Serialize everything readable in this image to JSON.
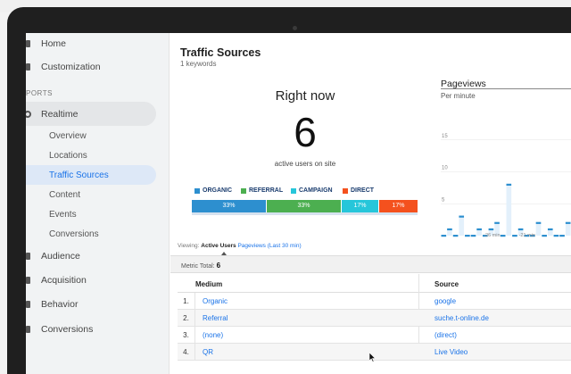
{
  "sidebar": {
    "home": "Home",
    "customization": "Customization",
    "section": "PORTS",
    "realtime": "Realtime",
    "sub_items": [
      "Overview",
      "Locations",
      "Traffic Sources",
      "Content",
      "Events",
      "Conversions"
    ],
    "audience": "Audience",
    "acquisition": "Acquisition",
    "behavior": "Behavior",
    "conversions": "Conversions"
  },
  "header": {
    "title": "Traffic Sources",
    "subtitle": "1 keywords"
  },
  "right_now": {
    "label": "Right now",
    "count": "6",
    "caption": "active users on site"
  },
  "legend": [
    {
      "label": "ORGANIC",
      "color": "#2d8fcf"
    },
    {
      "label": "REFERRAL",
      "color": "#4caf50"
    },
    {
      "label": "CAMPAIGN",
      "color": "#26c6da"
    },
    {
      "label": "DIRECT",
      "color": "#f4511e"
    }
  ],
  "distribution": [
    {
      "label": "33%",
      "value": 33.3,
      "color": "#2d8fcf"
    },
    {
      "label": "33%",
      "value": 33.3,
      "color": "#4caf50"
    },
    {
      "label": "17%",
      "value": 16.7,
      "color": "#26c6da"
    },
    {
      "label": "17%",
      "value": 16.7,
      "color": "#f4511e"
    }
  ],
  "pageviews": {
    "title": "Pageviews",
    "subtitle": "Per minute",
    "chart_data": {
      "type": "bar",
      "y_ticks": [
        "15",
        "10",
        "5"
      ],
      "x_labels": [
        "-26 min",
        "-21 min"
      ],
      "values": [
        0,
        1,
        0,
        3,
        0,
        0,
        1,
        0,
        1,
        2,
        0,
        8,
        0,
        1,
        0,
        0,
        2,
        0,
        1,
        0,
        0,
        2
      ],
      "ylim": [
        0,
        20
      ]
    }
  },
  "viewing": {
    "prefix": "Viewing:",
    "active": "Active Users",
    "alt": "Pageviews (Last 30 min)"
  },
  "metric_total": {
    "label": "Metric Total:",
    "value": "6"
  },
  "table": {
    "headers": [
      "Medium",
      "Source"
    ],
    "rows": [
      {
        "num": "1.",
        "medium": "Organic",
        "source": "google"
      },
      {
        "num": "2.",
        "medium": "Referral",
        "source": "suche.t-online.de"
      },
      {
        "num": "3.",
        "medium": "(none)",
        "source": "(direct)"
      },
      {
        "num": "4.",
        "medium": "QR",
        "source": "Live Video"
      }
    ]
  }
}
